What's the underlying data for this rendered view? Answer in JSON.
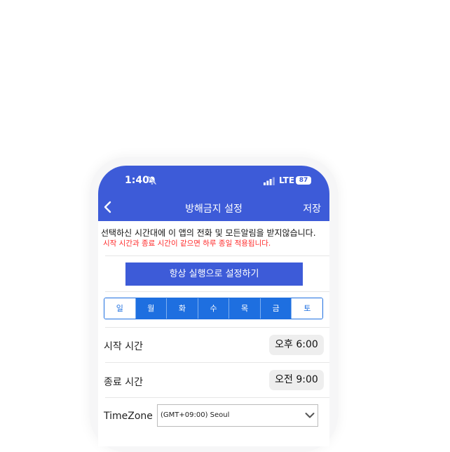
{
  "status": {
    "time": "1:40",
    "network": "LTE",
    "battery": "87"
  },
  "header": {
    "title": "방해금지 설정",
    "save_label": "저장"
  },
  "notice": {
    "line1": "선택하신 시간대에 이 앱의 전화 및 모든알림을 받지않습니다.",
    "line2": "시작 시간과 종료 시간이 같으면 하루 종일 적용됩니다."
  },
  "always_button": "항상 실행으로 설정하기",
  "days": [
    {
      "label": "일",
      "selected": false
    },
    {
      "label": "월",
      "selected": true
    },
    {
      "label": "화",
      "selected": true
    },
    {
      "label": "수",
      "selected": true
    },
    {
      "label": "목",
      "selected": true
    },
    {
      "label": "금",
      "selected": true
    },
    {
      "label": "토",
      "selected": false
    }
  ],
  "start": {
    "label": "시작 시간",
    "value": "오후 6:00"
  },
  "end": {
    "label": "종료 시간",
    "value": "오전 9:00"
  },
  "timezone": {
    "label": "TimeZone",
    "value": "(GMT+09:00) Seoul"
  },
  "colors": {
    "accent": "#3d5bd8",
    "day_selected": "#1e6fe0",
    "warning": "#ff2b2b"
  }
}
